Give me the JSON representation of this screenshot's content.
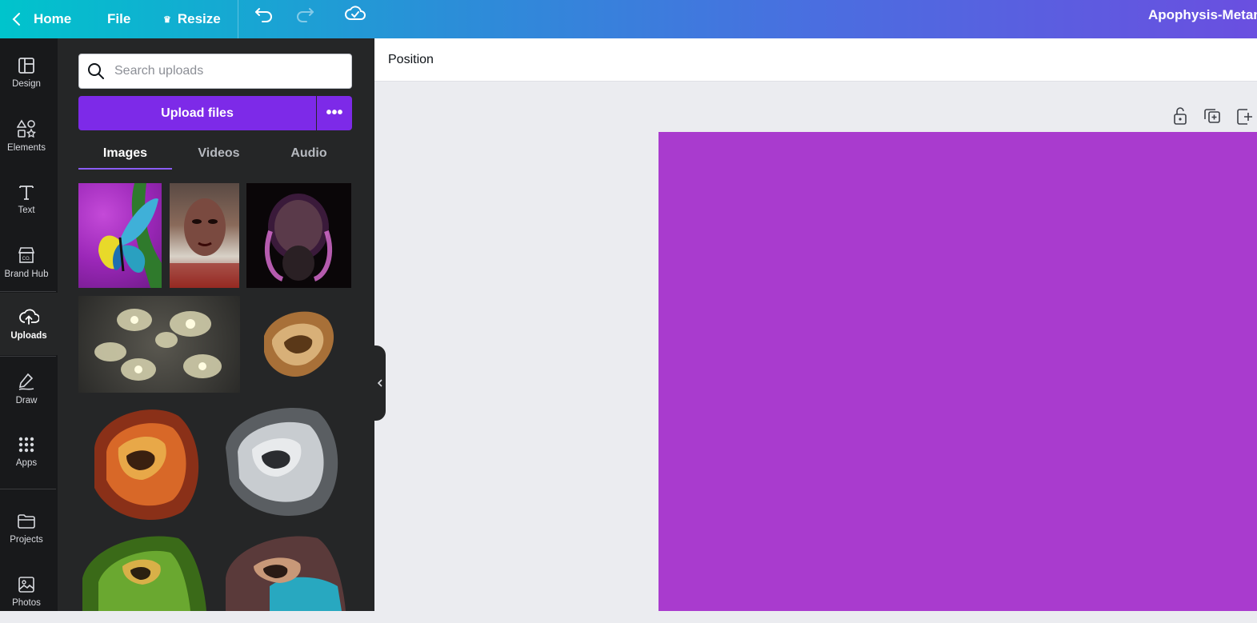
{
  "topbar": {
    "home_label": "Home",
    "file_label": "File",
    "resize_label": "Resize",
    "design_title": "Apophysis-Metam"
  },
  "rail": {
    "items": [
      {
        "label": "Design",
        "icon": "layout-icon"
      },
      {
        "label": "Elements",
        "icon": "shapes-icon"
      },
      {
        "label": "Text",
        "icon": "text-icon"
      },
      {
        "label": "Brand Hub",
        "icon": "brand-icon"
      },
      {
        "label": "Uploads",
        "icon": "cloud-upload-icon"
      },
      {
        "label": "Draw",
        "icon": "pen-icon"
      },
      {
        "label": "Apps",
        "icon": "grid-icon"
      },
      {
        "label": "Projects",
        "icon": "folder-icon"
      },
      {
        "label": "Photos",
        "icon": "image-icon"
      }
    ],
    "active": "Uploads"
  },
  "panel": {
    "search_placeholder": "Search uploads",
    "upload_label": "Upload files",
    "tabs": [
      "Images",
      "Videos",
      "Audio"
    ],
    "active_tab": "Images"
  },
  "context_toolbar": {
    "position_label": "Position"
  },
  "colors": {
    "accent": "#7d2ae8",
    "page_fill": "#a93bce",
    "rail_bg": "#18191b",
    "panel_bg": "#252627"
  }
}
